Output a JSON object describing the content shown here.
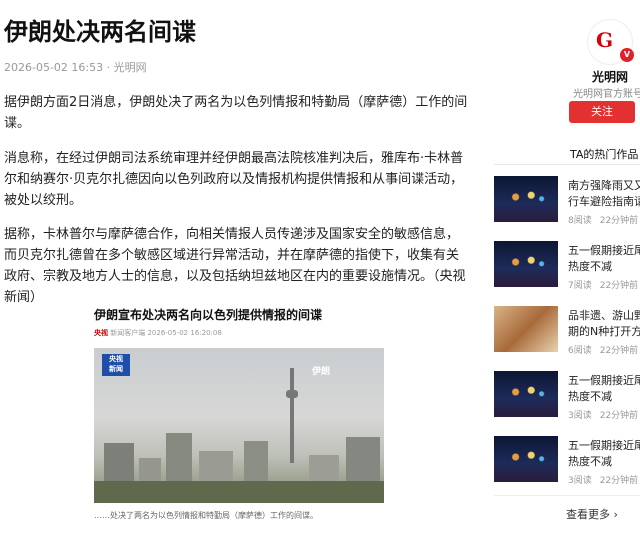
{
  "article": {
    "title": "伊朗处决两名间谍",
    "meta": "2026-05-02 16:53 · 光明网",
    "paragraphs": [
      "据伊朗方面2日消息，伊朗处决了两名为以色列情报和特勤局（摩萨德）工作的间谍。",
      "消息称，在经过伊朗司法系统审理并经伊朗最高法院核准判决后，雅库布·卡林普尔和纳赛尔·贝克尔扎德因向以色列政府以及情报机构提供情报和从事间谍活动，被处以绞刑。",
      "据称，卡林普尔与摩萨德合作，向相关情报人员传递涉及国家安全的敏感信息，而贝克尔扎德曾在多个敏感区域进行异常活动，并在摩萨德的指使下，收集有关政府、宗教及地方人士的信息，以及包括纳坦兹地区在内的重要设施情况。（央视新闻）"
    ],
    "card": {
      "title": "伊朗宣布处决两名向以色列提供情报的间谍",
      "source": "央视",
      "meta": "新闻客户端  2026-05-02 16:20:08",
      "logo_line1": "央视",
      "logo_line2": "新闻",
      "location_label": "伊朗",
      "caption": "……处决了两名为以色列情报和特勤局（摩萨德）工作的间谍。"
    }
  },
  "sidebar": {
    "account": {
      "logo_letter": "G",
      "badge": "V",
      "name": "光明网",
      "desc": "光明网官方账号",
      "follow_label": "关注"
    },
    "hot_title": "TA的热门作品",
    "items": [
      {
        "title": "南方强降雨又又",
        "title2": "行车避险指南请",
        "reads": "8阅读",
        "time": "22分钟前",
        "thumb": "night"
      },
      {
        "title": "五一假期接近尾",
        "title2": "热度不减",
        "reads": "7阅读",
        "time": "22分钟前",
        "thumb": "night"
      },
      {
        "title": "品非遗、游山野",
        "title2": "期的N种打开方",
        "reads": "6阅读",
        "time": "22分钟前",
        "thumb": "food"
      },
      {
        "title": "五一假期接近尾",
        "title2": "热度不减",
        "reads": "3阅读",
        "time": "22分钟前",
        "thumb": "night"
      },
      {
        "title": "五一假期接近尾",
        "title2": "热度不减",
        "reads": "3阅读",
        "time": "22分钟前",
        "thumb": "night"
      }
    ],
    "more_label": "查看更多 ›"
  }
}
